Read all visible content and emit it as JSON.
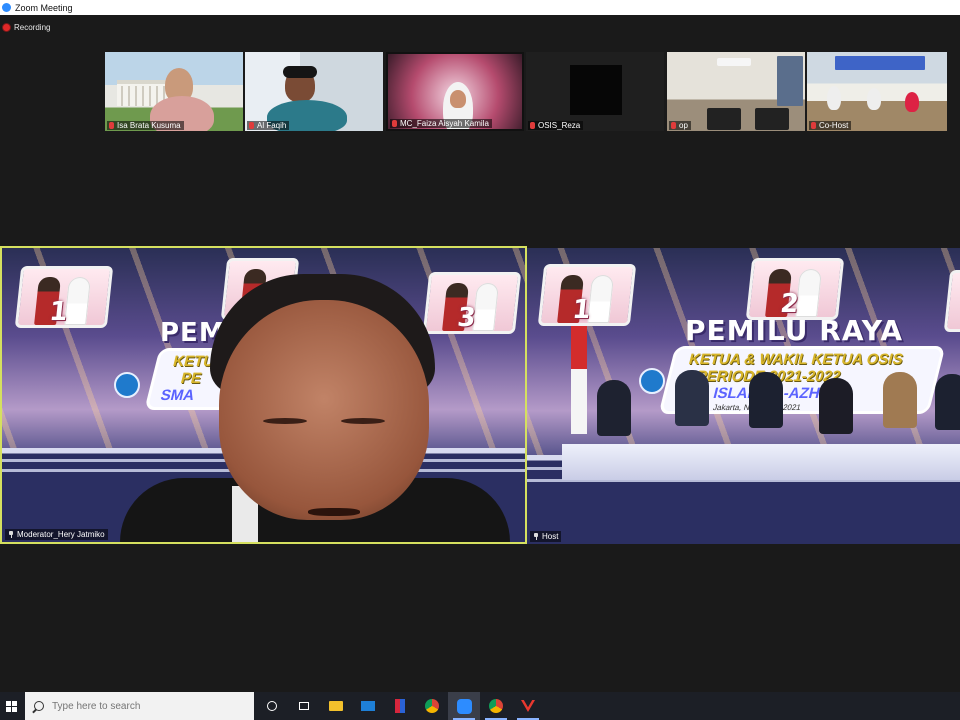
{
  "window": {
    "title": "Zoom Meeting"
  },
  "recording": {
    "label": "Recording"
  },
  "thumbnails": [
    {
      "name": "Isa Brata Kusuma"
    },
    {
      "name": "Al Faqih"
    },
    {
      "name": "MC_Faiza Aisyah Kamila"
    },
    {
      "name": "OSIS_Reza"
    },
    {
      "name": "op"
    },
    {
      "name": "Co-Host"
    }
  ],
  "left_tile": {
    "name": "Moderator_Hery Jatmiko",
    "stage_title": "PEMI",
    "banner_l1": "KETUA",
    "banner_l2": "PE",
    "banner_l3": "SMA",
    "frame_numbers": [
      "1",
      "3"
    ]
  },
  "right_tile": {
    "name": "Host",
    "stage_title": "PEMILU RAYA",
    "banner_l1": "KETUA & WAKIL KETUA OSIS",
    "banner_l2": "PERIODE 2021-2022",
    "banner_l3": "SMA ISLAM AL-AZHAR",
    "banner_l4": "Jakarta, November 2021",
    "frame_numbers": [
      "1",
      "2"
    ]
  },
  "taskbar": {
    "search_placeholder": "Type here to search",
    "icons": [
      "windows-start-icon",
      "task-view-circle-icon",
      "task-view-icon",
      "file-explorer-icon",
      "mail-icon",
      "app-icon",
      "chrome-icon",
      "zoom-icon",
      "chrome-icon",
      "app-icon"
    ]
  },
  "colors": {
    "active_speaker_border": "#d5e05f",
    "mic_muted": "#e03b3b",
    "taskbar": "#1c1f26"
  }
}
